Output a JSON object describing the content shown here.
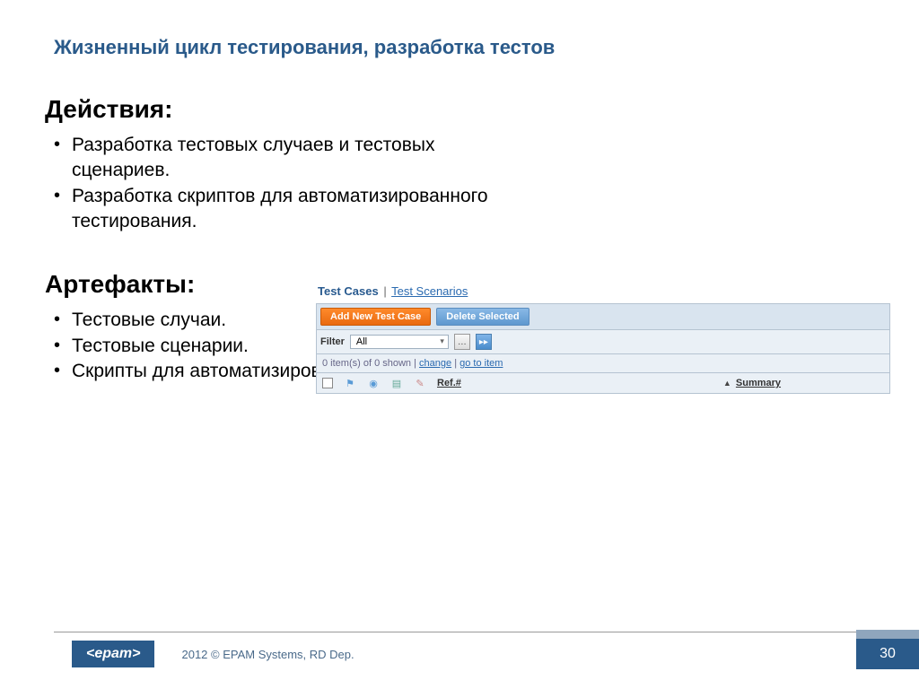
{
  "title": "Жизненный цикл тестирования, разработка тестов",
  "actions": {
    "heading": "Действия:",
    "items": [
      "Разработка тестовых случаев и тестовых сценариев.",
      "Разработка скриптов для автоматизированного тестирования."
    ]
  },
  "artifacts": {
    "heading": "Артефакты:",
    "items": [
      "Тестовые случаи.",
      "Тестовые сценарии.",
      "Скрипты для автоматизированного тестирования."
    ]
  },
  "ui": {
    "tabs": {
      "active": "Test Cases",
      "sep": "|",
      "inactive": "Test Scenarios"
    },
    "buttons": {
      "add": "Add New Test Case",
      "delete": "Delete Selected"
    },
    "filter": {
      "label": "Filter",
      "value": "All"
    },
    "status": {
      "count": "0 item(s) of 0 shown",
      "sep": "|",
      "change": "change",
      "goto": "go to item"
    },
    "columns": {
      "ref": "Ref.#",
      "summary": "Summary"
    }
  },
  "footer": {
    "brand": "<epam>",
    "copyright": "2012 © EPAM Systems, RD Dep.",
    "page": "30"
  }
}
